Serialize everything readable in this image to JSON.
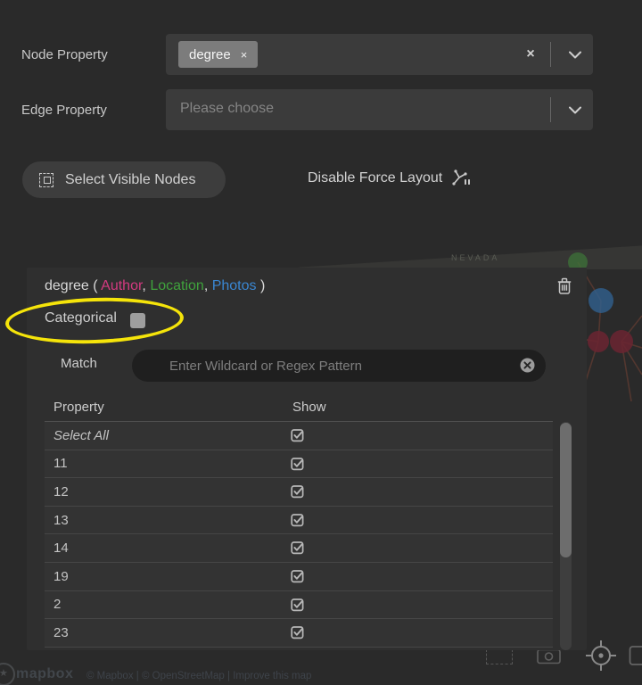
{
  "colors": {
    "author": "#d33a80",
    "location": "#3fa23c",
    "photos": "#3a86d1",
    "annotation": "#f5e40a"
  },
  "node_property": {
    "label": "Node Property",
    "selected_chip": "degree",
    "chip_remove_icon": "×",
    "clear_icon": "×"
  },
  "edge_property": {
    "label": "Edge Property",
    "placeholder": "Please choose"
  },
  "actions": {
    "select_visible_nodes": "Select Visible Nodes",
    "disable_force_layout": "Disable Force Layout"
  },
  "filter_panel": {
    "title_parts": [
      {
        "text": "degree ( ",
        "color": "#d8d8d8"
      },
      {
        "text": "Author",
        "color": "#d33a80"
      },
      {
        "text": ", ",
        "color": "#d8d8d8"
      },
      {
        "text": "Location",
        "color": "#3fa23c"
      },
      {
        "text": ", ",
        "color": "#d8d8d8"
      },
      {
        "text": "Photos",
        "color": "#3a86d1"
      },
      {
        "text": " )",
        "color": "#d8d8d8"
      }
    ],
    "categorical_label": "Categorical",
    "categorical_checked": false,
    "match_label": "Match",
    "match_placeholder": "Enter Wildcard or Regex Pattern",
    "match_value": "",
    "table": {
      "columns": [
        "Property",
        "Show"
      ],
      "rows": [
        {
          "label": "Select All",
          "italic": true,
          "checked": true
        },
        {
          "label": "11",
          "italic": false,
          "checked": true
        },
        {
          "label": "12",
          "italic": false,
          "checked": true
        },
        {
          "label": "13",
          "italic": false,
          "checked": true
        },
        {
          "label": "14",
          "italic": false,
          "checked": true
        },
        {
          "label": "19",
          "italic": false,
          "checked": true
        },
        {
          "label": "2",
          "italic": false,
          "checked": true
        },
        {
          "label": "23",
          "italic": false,
          "checked": true
        }
      ]
    }
  },
  "map": {
    "region_label": "NEVADA",
    "attribution_logo": "mapbox",
    "attribution_text": "© Mapbox | © OpenStreetMap | Improve this map"
  }
}
